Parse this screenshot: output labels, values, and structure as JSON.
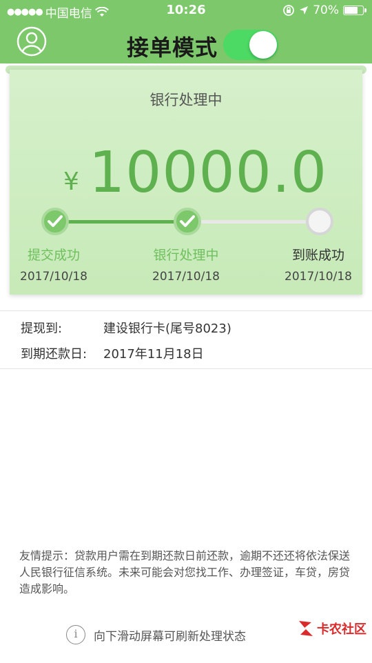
{
  "status_bar": {
    "carrier": "中国电信",
    "time": "10:26",
    "battery": "70%"
  },
  "header": {
    "title": "接单模式",
    "toggle_on": true
  },
  "card": {
    "status": "银行处理中",
    "currency": "¥",
    "amount": "10000.0",
    "steps": [
      {
        "label": "提交成功",
        "date": "2017/10/18",
        "done": true
      },
      {
        "label": "银行处理中",
        "date": "2017/10/18",
        "done": true
      },
      {
        "label": "到账成功",
        "date": "2017/10/18",
        "done": false
      }
    ]
  },
  "info": {
    "withdraw_label": "提现到:",
    "withdraw_value": "建设银行卡(尾号8023)",
    "due_label": "到期还款日:",
    "due_value": "2017年11月18日"
  },
  "tip": "友情提示：贷款用户需在到期还款日前还款，逾期不还还将依法保送人民银行征信系统。未来可能会对您找工作、办理签证，车贷，房贷造成影响。",
  "refresh_hint": "向下滑动屏幕可刷新处理状态",
  "watermark": "卡农社区",
  "colors": {
    "accent": "#7dc86b",
    "amount": "#5fb04f",
    "toggle": "#4cd964"
  }
}
